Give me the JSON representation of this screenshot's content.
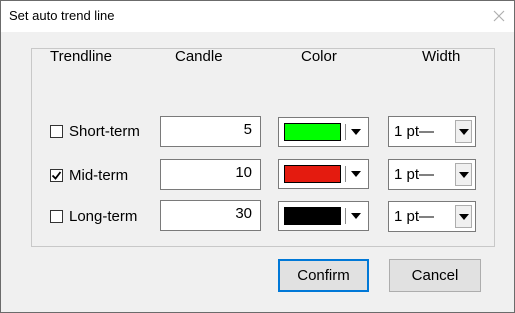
{
  "window": {
    "title": "Set auto trend line"
  },
  "headers": {
    "trendline": "Trendline",
    "candle": "Candle",
    "color": "Color",
    "width": "Width"
  },
  "rows": [
    {
      "label": "Short-term",
      "checked": false,
      "candle": "5",
      "color": "#00ff00",
      "width": "1 pt—"
    },
    {
      "label": "Mid-term",
      "checked": true,
      "candle": "10",
      "color": "#e41b0f",
      "width": "1 pt—"
    },
    {
      "label": "Long-term",
      "checked": false,
      "candle": "30",
      "color": "#000000",
      "width": "1 pt—"
    }
  ],
  "buttons": {
    "confirm": "Confirm",
    "cancel": "Cancel"
  },
  "icons": {
    "close": "close-icon",
    "check": "check-icon",
    "dropdown": "chevron-down-icon"
  }
}
